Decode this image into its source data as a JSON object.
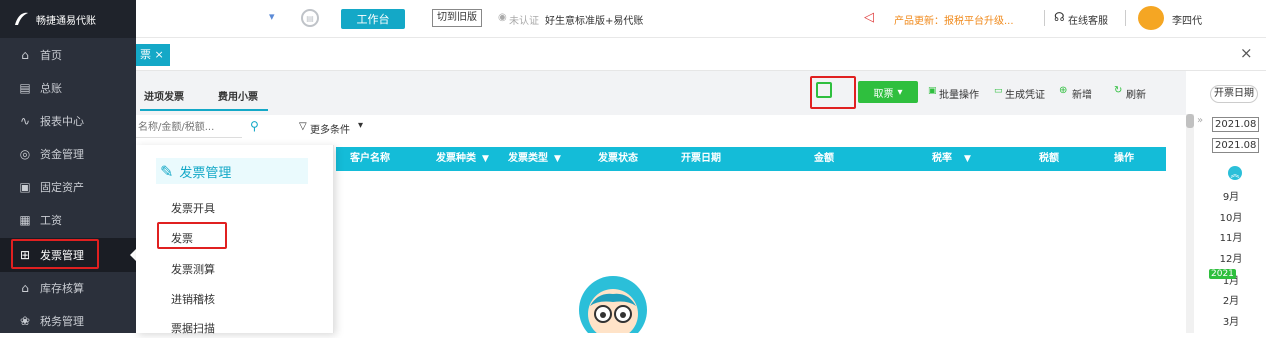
{
  "app": {
    "logo_text": "畅捷通易代账",
    "workbench_label": "工作台",
    "switch_old_label": "切到旧版",
    "cert_status": "未认证",
    "product_name": "好生意标准版+易代账",
    "product_update": "产品更新：报税平台升级...",
    "online_service": "在线客服",
    "username": "李四代"
  },
  "sidebar": {
    "items": [
      {
        "label": "首页",
        "icon": "home-icon",
        "glyph": "⌂"
      },
      {
        "label": "总账",
        "icon": "ledger-icon",
        "glyph": "▤"
      },
      {
        "label": "报表中心",
        "icon": "report-chart-icon",
        "glyph": "∿"
      },
      {
        "label": "资金管理",
        "icon": "fund-icon",
        "glyph": "◎"
      },
      {
        "label": "固定资产",
        "icon": "asset-icon",
        "glyph": "▣"
      },
      {
        "label": "工资",
        "icon": "salary-icon",
        "glyph": "▦"
      },
      {
        "label": "发票管理",
        "icon": "invoice-icon",
        "glyph": "⊞"
      },
      {
        "label": "库存核算",
        "icon": "warehouse-icon",
        "glyph": "⌂"
      },
      {
        "label": "税务管理",
        "icon": "tax-icon",
        "glyph": "❀"
      }
    ]
  },
  "tabs": {
    "open_tab_label": "票",
    "close_symbol": "×",
    "window_close": "×"
  },
  "subtabs": [
    "进项发票",
    "费用小票"
  ],
  "toolbar": {
    "qr_label": "",
    "take_ticket": "取票",
    "batch_ops": "批量操作",
    "gen_voucher": "生成凭证",
    "add_new": "新增",
    "refresh": "刷新",
    "invoice_date": "开票日期"
  },
  "filter": {
    "search_placeholder": "名称/金额/税额...",
    "more_conditions": "更多条件"
  },
  "table": {
    "columns": [
      "客户名称",
      "发票种类",
      "发票类型",
      "发票状态",
      "开票日期",
      "金额",
      "税率",
      "税额",
      "操作"
    ]
  },
  "dropdown": {
    "title": "发票管理",
    "items": [
      "发票开具",
      "发票",
      "发票测算",
      "进销稽核",
      "票据扫描"
    ]
  },
  "date_panel": {
    "range_start": "2021.08",
    "range_end": "2021.08",
    "year_badge": "2021",
    "months": [
      "9月",
      "10月",
      "11月",
      "12月",
      "1月",
      "2月",
      "3月"
    ]
  },
  "colors": {
    "accent": "#14a8c7",
    "green": "#2fbf3e",
    "sidebar_bg": "#2b303b",
    "highlight_red": "#e02020"
  }
}
